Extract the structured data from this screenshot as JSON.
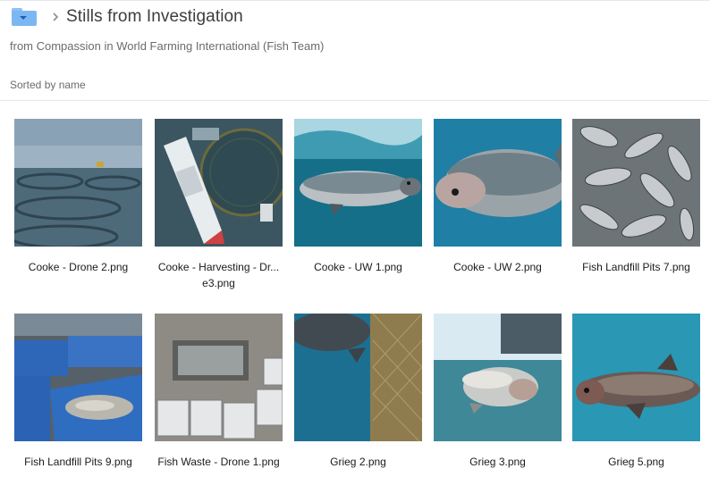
{
  "header": {
    "title": "Stills from Investigation",
    "owner": "from Compassion in World Farming International (Fish Team)",
    "sort_label": "Sorted by name",
    "folder_icon": "folder-icon",
    "chevron_icon": "chevron-right-icon"
  },
  "files": [
    {
      "name": "Cooke - Drone 2.png"
    },
    {
      "name": "Cooke - Harvesting - Dr... e3.png"
    },
    {
      "name": "Cooke - UW 1.png"
    },
    {
      "name": "Cooke - UW 2.png"
    },
    {
      "name": "Fish Landfill Pits 7.png"
    },
    {
      "name": "Fish Landfill Pits 9.png"
    },
    {
      "name": "Fish Waste - Drone 1.png"
    },
    {
      "name": "Grieg 2.png"
    },
    {
      "name": "Grieg 3.png"
    },
    {
      "name": "Grieg 5.png"
    }
  ]
}
